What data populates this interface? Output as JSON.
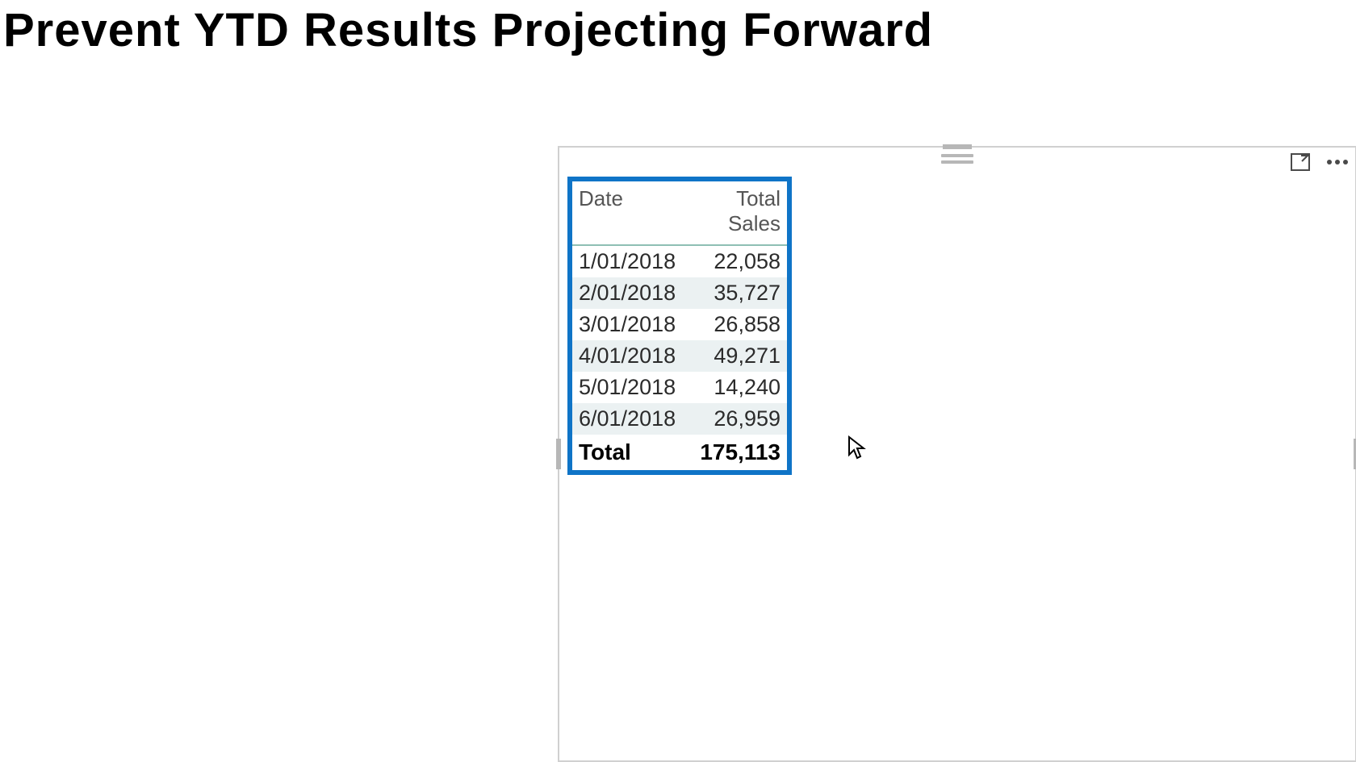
{
  "page": {
    "title": "Prevent YTD Results Projecting Forward"
  },
  "chart_data": {
    "type": "table",
    "columns": [
      "Date",
      "Total Sales"
    ],
    "rows": [
      {
        "date": "1/01/2018",
        "value": "22,058"
      },
      {
        "date": "2/01/2018",
        "value": "35,727"
      },
      {
        "date": "3/01/2018",
        "value": "26,858"
      },
      {
        "date": "4/01/2018",
        "value": "49,271"
      },
      {
        "date": "5/01/2018",
        "value": "14,240"
      },
      {
        "date": "6/01/2018",
        "value": "26,959"
      }
    ],
    "total": {
      "label": "Total",
      "value": "175,113"
    }
  }
}
